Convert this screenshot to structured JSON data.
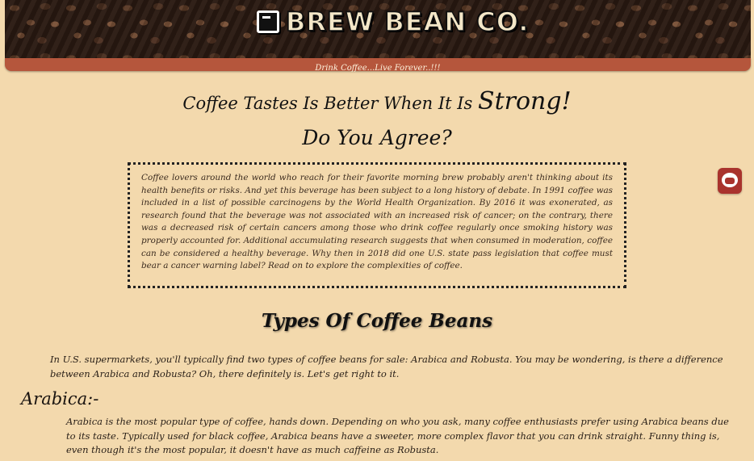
{
  "header": {
    "logo_text": "BREW BEAN CO.",
    "tagline": "Drink Coffee...Live Forever..!!!"
  },
  "hero": {
    "headline": "Coffee Tastes Is Better When It Is",
    "headline_emphasis": "Strong!",
    "subhead": "Do You Agree?"
  },
  "intro": {
    "paragraph": "Coffee lovers around the world who reach for their favorite morning brew probably aren't thinking about its health benefits or risks. And yet this beverage has been subject to a long history of debate. In 1991 coffee was included in a list of possible carcinogens by the World Health Organization. By 2016 it was exonerated, as research found that the beverage was not associated with an increased risk of cancer; on the contrary, there was a decreased risk of certain cancers among those who drink coffee regularly once smoking history was properly accounted for. Additional accumulating research suggests that when consumed in moderation, coffee can be considered a healthy beverage. Why then in 2018 did one U.S. state pass legislation that coffee must bear a cancer warning label? Read on to explore the complexities of coffee."
  },
  "types": {
    "title": "Types Of Coffee Beans",
    "intro": "In U.S. supermarkets, you'll typically find two types of coffee beans for sale: Arabica and Robusta. You may be wondering, is there a difference between Arabica and Robusta? Oh, there definitely is. Let's get right to it.",
    "arabica_title": "Arabica:-",
    "arabica_text": "Arabica is the most popular type of coffee, hands down. Depending on who you ask, many coffee enthusiasts prefer using Arabica beans due to its taste. Typically used for black coffee, Arabica beans have a sweeter, more complex flavor that you can drink straight. Funny thing is, even though it's the most popular, it doesn't have as much caffeine as Robusta."
  },
  "icons": {
    "logo": "coffee-cup-icon",
    "support": "headset-support-icon"
  },
  "colors": {
    "page_background": "#f3d9ad",
    "tagline_bar": "#b5563c",
    "support_icon": "#a9332d"
  }
}
